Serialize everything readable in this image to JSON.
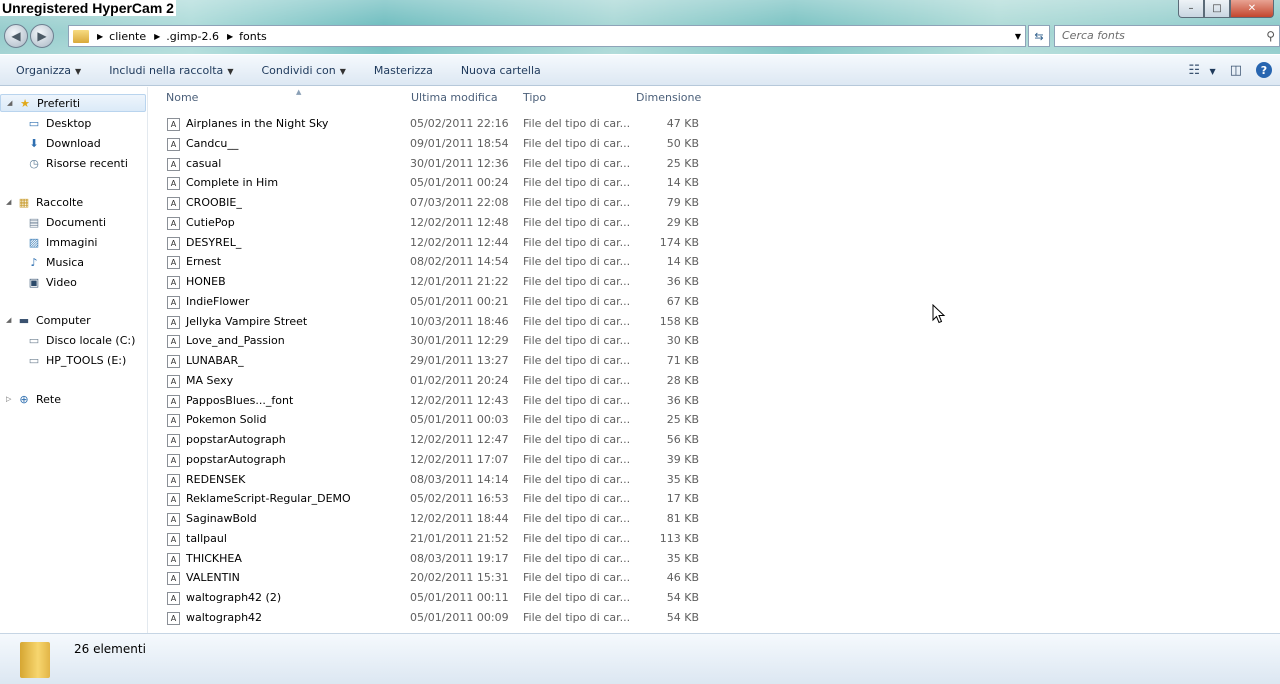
{
  "watermark": "Unregistered HyperCam 2",
  "window_buttons": {
    "minimize": "–",
    "maximize": "□",
    "close": "✕"
  },
  "nav": {
    "back": "◀",
    "forward": "▶"
  },
  "address": {
    "crumbs": [
      "cliente",
      ".gimp-2.6",
      "fonts"
    ],
    "separator": "▶",
    "dropdown": "▼",
    "refresh": "⇆"
  },
  "search": {
    "placeholder": "Cerca fonts",
    "icon": "⚲"
  },
  "toolbar": {
    "items": [
      {
        "label": "Organizza",
        "arrow": "▼"
      },
      {
        "label": "Includi nella raccolta",
        "arrow": "▼"
      },
      {
        "label": "Condividi con",
        "arrow": "▼"
      },
      {
        "label": "Masterizza",
        "arrow": ""
      },
      {
        "label": "Nuova cartella",
        "arrow": ""
      }
    ],
    "views_icon": "☷",
    "views_arrow": "▼",
    "preview_icon": "◫",
    "help_icon": "?"
  },
  "sidebar": {
    "items": [
      {
        "label": "Preferiti",
        "icon": "★",
        "expander": "◢"
      },
      {
        "label": "Desktop",
        "icon": "▭",
        "expander": ""
      },
      {
        "label": "Download",
        "icon": "⬇",
        "expander": ""
      },
      {
        "label": "Risorse recenti",
        "icon": "◷",
        "expander": ""
      },
      {
        "label": "Raccolte",
        "icon": "▦",
        "expander": "◢"
      },
      {
        "label": "Documenti",
        "icon": "▤",
        "expander": ""
      },
      {
        "label": "Immagini",
        "icon": "▨",
        "expander": ""
      },
      {
        "label": "Musica",
        "icon": "♪",
        "expander": ""
      },
      {
        "label": "Video",
        "icon": "▣",
        "expander": ""
      },
      {
        "label": "Computer",
        "icon": "▬",
        "expander": "◢"
      },
      {
        "label": "Disco locale (C:)",
        "icon": "▭",
        "expander": ""
      },
      {
        "label": "HP_TOOLS (E:)",
        "icon": "▭",
        "expander": ""
      },
      {
        "label": "Rete",
        "icon": "⊕",
        "expander": "▷"
      }
    ]
  },
  "columns": {
    "name": "Nome",
    "modified": "Ultima modifica",
    "type": "Tipo",
    "size": "Dimensione",
    "sort_arrow": "▲"
  },
  "file_icon": "A",
  "files": [
    {
      "name": "Airplanes in the Night Sky",
      "date": "05/02/2011 22:16",
      "type": "File del tipo di car...",
      "size": "47 KB"
    },
    {
      "name": "Candcu__",
      "date": "09/01/2011 18:54",
      "type": "File del tipo di car...",
      "size": "50 KB"
    },
    {
      "name": "casual",
      "date": "30/01/2011 12:36",
      "type": "File del tipo di car...",
      "size": "25 KB"
    },
    {
      "name": "Complete in Him",
      "date": "05/01/2011 00:24",
      "type": "File del tipo di car...",
      "size": "14 KB"
    },
    {
      "name": "CROOBIE_",
      "date": "07/03/2011 22:08",
      "type": "File del tipo di car...",
      "size": "79 KB"
    },
    {
      "name": "CutiePop",
      "date": "12/02/2011 12:48",
      "type": "File del tipo di car...",
      "size": "29 KB"
    },
    {
      "name": "DESYREL_",
      "date": "12/02/2011 12:44",
      "type": "File del tipo di car...",
      "size": "174 KB"
    },
    {
      "name": "Ernest",
      "date": "08/02/2011 14:54",
      "type": "File del tipo di car...",
      "size": "14 KB"
    },
    {
      "name": "HONEB",
      "date": "12/01/2011 21:22",
      "type": "File del tipo di car...",
      "size": "36 KB"
    },
    {
      "name": "IndieFlower",
      "date": "05/01/2011 00:21",
      "type": "File del tipo di car...",
      "size": "67 KB"
    },
    {
      "name": "Jellyka Vampire Street",
      "date": "10/03/2011 18:46",
      "type": "File del tipo di car...",
      "size": "158 KB"
    },
    {
      "name": "Love_and_Passion",
      "date": "30/01/2011 12:29",
      "type": "File del tipo di car...",
      "size": "30 KB"
    },
    {
      "name": "LUNABAR_",
      "date": "29/01/2011 13:27",
      "type": "File del tipo di car...",
      "size": "71 KB"
    },
    {
      "name": "MA Sexy",
      "date": "01/02/2011 20:24",
      "type": "File del tipo di car...",
      "size": "28 KB"
    },
    {
      "name": "PapposBlues..._font",
      "date": "12/02/2011 12:43",
      "type": "File del tipo di car...",
      "size": "36 KB"
    },
    {
      "name": "Pokemon Solid",
      "date": "05/01/2011 00:03",
      "type": "File del tipo di car...",
      "size": "25 KB"
    },
    {
      "name": "popstarAutograph",
      "date": "12/02/2011 12:47",
      "type": "File del tipo di car...",
      "size": "56 KB"
    },
    {
      "name": "popstarAutograph",
      "date": "12/02/2011 17:07",
      "type": "File del tipo di car...",
      "size": "39 KB"
    },
    {
      "name": "REDENSEK",
      "date": "08/03/2011 14:14",
      "type": "File del tipo di car...",
      "size": "35 KB"
    },
    {
      "name": "ReklameScript-Regular_DEMO",
      "date": "05/02/2011 16:53",
      "type": "File del tipo di car...",
      "size": "17 KB"
    },
    {
      "name": "SaginawBold",
      "date": "12/02/2011 18:44",
      "type": "File del tipo di car...",
      "size": "81 KB"
    },
    {
      "name": "tallpaul",
      "date": "21/01/2011 21:52",
      "type": "File del tipo di car...",
      "size": "113 KB"
    },
    {
      "name": "THICKHEA",
      "date": "08/03/2011 19:17",
      "type": "File del tipo di car...",
      "size": "35 KB"
    },
    {
      "name": "VALENTIN",
      "date": "20/02/2011 15:31",
      "type": "File del tipo di car...",
      "size": "46 KB"
    },
    {
      "name": "waltograph42 (2)",
      "date": "05/01/2011 00:11",
      "type": "File del tipo di car...",
      "size": "54 KB"
    },
    {
      "name": "waltograph42",
      "date": "05/01/2011 00:09",
      "type": "File del tipo di car...",
      "size": "54 KB"
    }
  ],
  "status": {
    "count": "26 elementi"
  }
}
